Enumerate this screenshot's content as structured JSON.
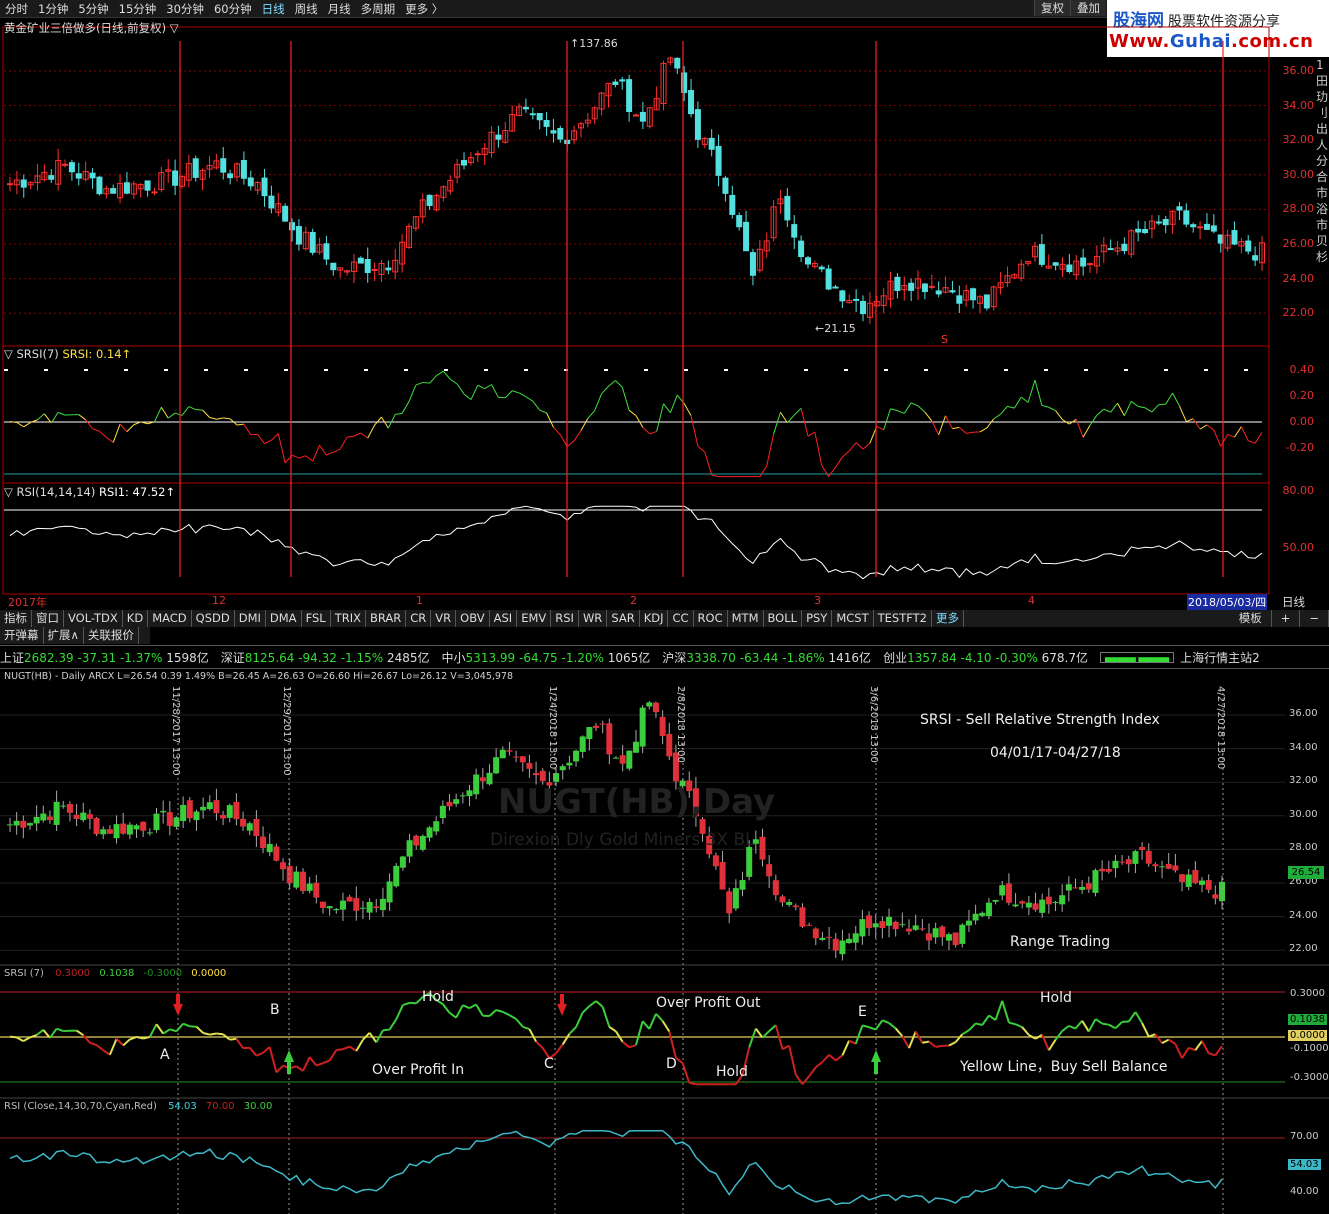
{
  "toolbar_top": {
    "timeframes": [
      "分时",
      "1分钟",
      "5分钟",
      "15分钟",
      "30分钟",
      "60分钟",
      "日线",
      "周线",
      "月线",
      "多周期",
      "更多 〉"
    ],
    "active": "日线",
    "right_buttons": [
      "复权",
      "叠加"
    ]
  },
  "logo": {
    "line1_a": "股海网",
    "line1_b": "股票软件资源分享",
    "line2_a": "Www.",
    "line2_b": "Guhai",
    "line2_c": ".com.cn"
  },
  "sidebar_text": [
    "1",
    "田",
    "玏",
    "刂",
    "出",
    "人",
    "分",
    "合",
    "市",
    "浴",
    "市",
    "贝",
    "杉"
  ],
  "main_chart": {
    "title": "黄金矿业三倍做多(日线,前复权) ▽",
    "high_label": "137.86",
    "low_label": "21.15",
    "s_marker": "S",
    "y_ticks": [
      "36.00",
      "34.00",
      "32.00",
      "30.00",
      "28.00",
      "26.00",
      "24.00",
      "22.00"
    ]
  },
  "srsi_panel": {
    "title": "▽ SRSI(7)",
    "value_label": "SRSI: 0.14↑",
    "y_ticks": [
      "0.40",
      "0.20",
      "0.00",
      "-0.20"
    ]
  },
  "rsi_panel": {
    "title": "▽ RSI(14,14,14)",
    "value_label": "RSI1: 47.52↑",
    "y_ticks": [
      "80.00",
      "50.00"
    ]
  },
  "x_axis": {
    "labels": [
      "2017年",
      "12",
      "1",
      "2",
      "3",
      "4"
    ],
    "date_box": "2018/05/03/四",
    "period": "日线"
  },
  "indicator_tabs": [
    "指标",
    "窗口",
    "VOL-TDX",
    "KD",
    "MACD",
    "QSDD",
    "DMI",
    "DMA",
    "FSL",
    "TRIX",
    "BRAR",
    "CR",
    "VR",
    "OBV",
    "ASI",
    "EMV",
    "RSI",
    "WR",
    "SAR",
    "KDJ",
    "CC",
    "ROC",
    "MTM",
    "BOLL",
    "PSY",
    "MCST",
    "TESTFT2",
    "更多"
  ],
  "indicator_right": [
    "模板",
    "+",
    "−"
  ],
  "sub_tabs": [
    "开弹幕",
    "扩展∧",
    "关联报价"
  ],
  "ticker": [
    {
      "name": "上证",
      "price": "2682.39",
      "chg": "-37.31",
      "pct": "-1.37%",
      "vol": "1598亿"
    },
    {
      "name": "深证",
      "price": "8125.64",
      "chg": "-94.32",
      "pct": "-1.15%",
      "vol": "2485亿"
    },
    {
      "name": "中小",
      "price": "5313.99",
      "chg": "-64.75",
      "pct": "-1.20%",
      "vol": "1065亿"
    },
    {
      "name": "沪深",
      "price": "3338.70",
      "chg": "-63.44",
      "pct": "-1.86%",
      "vol": "1416亿"
    },
    {
      "name": "创业",
      "price": "1357.84",
      "chg": "-4.10",
      "pct": "-0.30%",
      "vol": "678.7亿"
    }
  ],
  "ticker_right": "上海行情主站2",
  "lower_chart": {
    "header": "NUGT(HB) - Daily   ARCX   L=26.54   0.39   1.49%   B=26.45   A=26.63   O=26.60   Hi=26.67   Lo=26.12   V=3,045,978",
    "watermark1": "NUGT(HB),Day",
    "watermark2": "Direxion Dly Gold Miners 3X BL",
    "title": "SRSI - Sell Relative Strength Index",
    "date_range": "04/01/17-04/27/18",
    "range_trading": "Range Trading",
    "price_box": "26.54",
    "y_ticks": [
      "36.00",
      "34.00",
      "32.00",
      "30.00",
      "28.00",
      "26.00",
      "24.00",
      "22.00"
    ],
    "vline_dates": [
      "11/28/2017 13:00",
      "12/29/2017 13:00",
      "1/24/2018 13:00",
      "2/8/2018 13:00",
      "3/6/2018 13:00",
      "4/27/2018 13:00"
    ],
    "srsi_header": "SRSI (7)",
    "srsi_vals": [
      "0.3000",
      "0.1038",
      "-0.3000",
      "0.0000"
    ],
    "srsi_ticks": [
      "0.3000",
      "0.1038",
      "0.0000",
      "-0.1000",
      "-0.3000"
    ],
    "annotations": {
      "a": "A",
      "b": "B",
      "c": "C",
      "d": "D",
      "e": "E",
      "hold1": "Hold",
      "hold2": "Hold",
      "hold3": "Hold",
      "over_in": "Over Profit In",
      "over_out": "Over Profit Out",
      "yellow": "Yellow Line，Buy Sell Balance"
    },
    "rsi_header": "RSI (Close,14,30,70,Cyan,Red)",
    "rsi_vals": [
      "54.03",
      "70.00",
      "30.00"
    ],
    "rsi_ticks": [
      "70.00",
      "54.03",
      "40.00"
    ]
  },
  "colors": {
    "up": "#ff3030",
    "down": "#55e0e0",
    "grid_red": "#b00000",
    "lower_up": "#e0303a",
    "lower_down": "#3ccd3c"
  }
}
